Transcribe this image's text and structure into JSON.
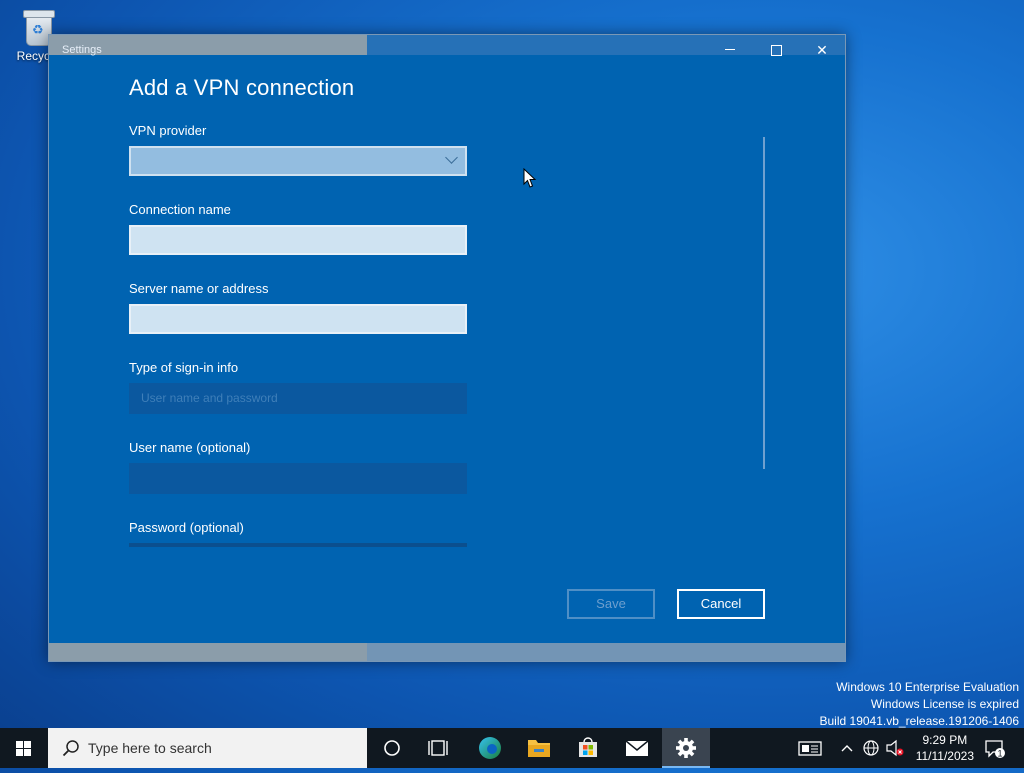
{
  "desktop": {
    "recycle_bin_label": "Recycle"
  },
  "window": {
    "title": "Settings",
    "heading": "Add a VPN connection",
    "fields": {
      "vpn_provider_label": "VPN provider",
      "connection_name_label": "Connection name",
      "server_label": "Server name or address",
      "signin_type_label": "Type of sign-in info",
      "signin_type_value": "User name and password",
      "username_label": "User name (optional)",
      "password_label": "Password (optional)"
    },
    "buttons": {
      "save": "Save",
      "cancel": "Cancel"
    }
  },
  "watermark": {
    "line1": "Windows 10 Enterprise Evaluation",
    "line2": "Windows License is expired",
    "line3": "Build 19041.vb_release.191206-1406"
  },
  "taskbar": {
    "search_placeholder": "Type here to search",
    "time": "9:29 PM",
    "date": "11/11/2023",
    "notification_count": "1"
  },
  "colors": {
    "accent": "#0063b1",
    "taskbar": "#101820"
  }
}
